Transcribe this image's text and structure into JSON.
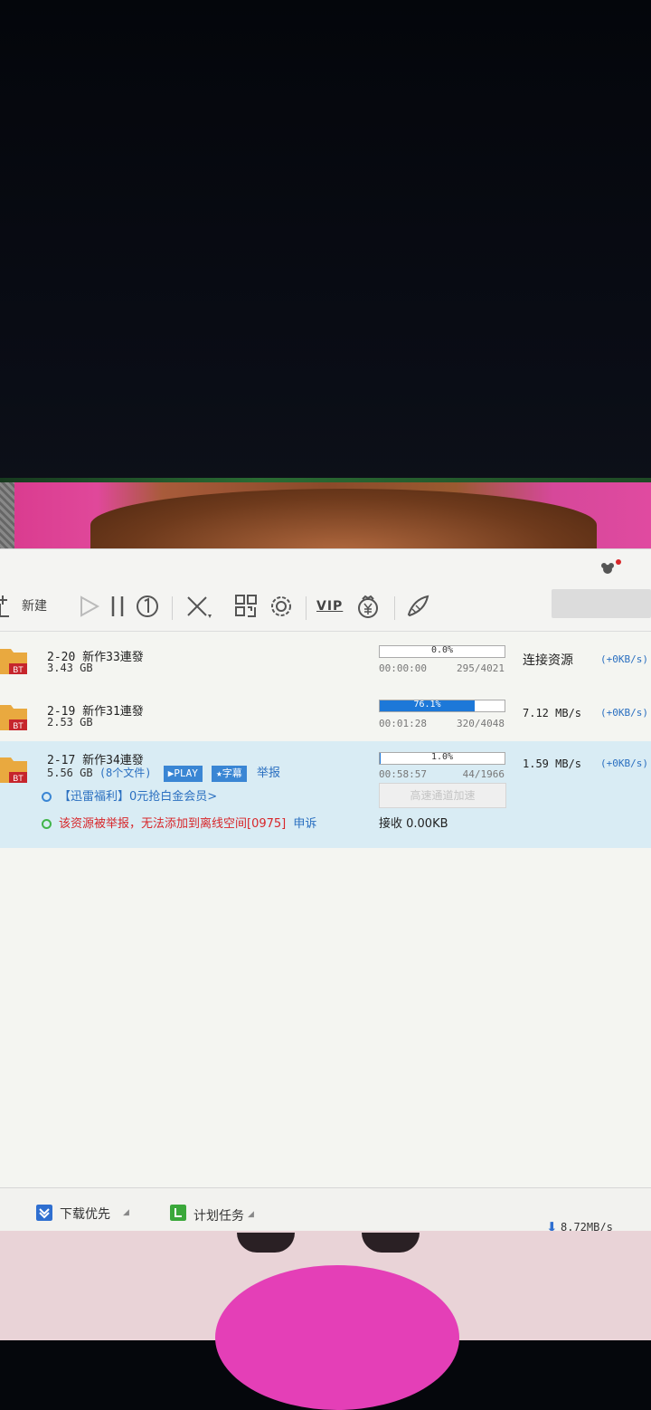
{
  "toolbar": {
    "new_label": "新建",
    "vip_label": "VIP",
    "colors": {
      "icon": "#555555",
      "accent": "#1d78d8"
    }
  },
  "tasks": [
    {
      "name": "2-20 新作33連發",
      "size": "3.43 GB",
      "progress_text": "0.0%",
      "progress": 0.0,
      "time": "00:00:00",
      "connections": "295/4021",
      "status": "连接资源",
      "extra": "(+0KB/s)"
    },
    {
      "name": "2-19 新作31連發",
      "size": "2.53 GB",
      "progress_text": "76.1%",
      "progress": 0.761,
      "time": "00:01:28",
      "connections": "320/4048",
      "speed": "7.12  MB/s",
      "extra": "(+0KB/s)"
    },
    {
      "name": "2-17 新作34連發",
      "size": "5.56 GB",
      "file_count": "(8个文件)",
      "play_badge": "▶PLAY",
      "subtitle_badge": "★字幕",
      "report_link": "举报",
      "progress_text": "1.0%",
      "progress": 0.01,
      "time": "00:58:57",
      "connections": "44/1966",
      "speed": "1.59  MB/s",
      "extra": "(+0KB/s)",
      "promo_text": "【迅雷福利】0元抢白金会员>",
      "warning_text": "该资源被举报，无法添加到离线空间[0975]",
      "appeal_link": "申诉",
      "accelerate_button": "高速通道加速",
      "receive_text": "接收 0.00KB"
    }
  ],
  "folder_badge": "BT",
  "statusbar": {
    "priority_label": "下载优先",
    "schedule_label": "计划任务",
    "total_speed": "8.72MB/s"
  }
}
